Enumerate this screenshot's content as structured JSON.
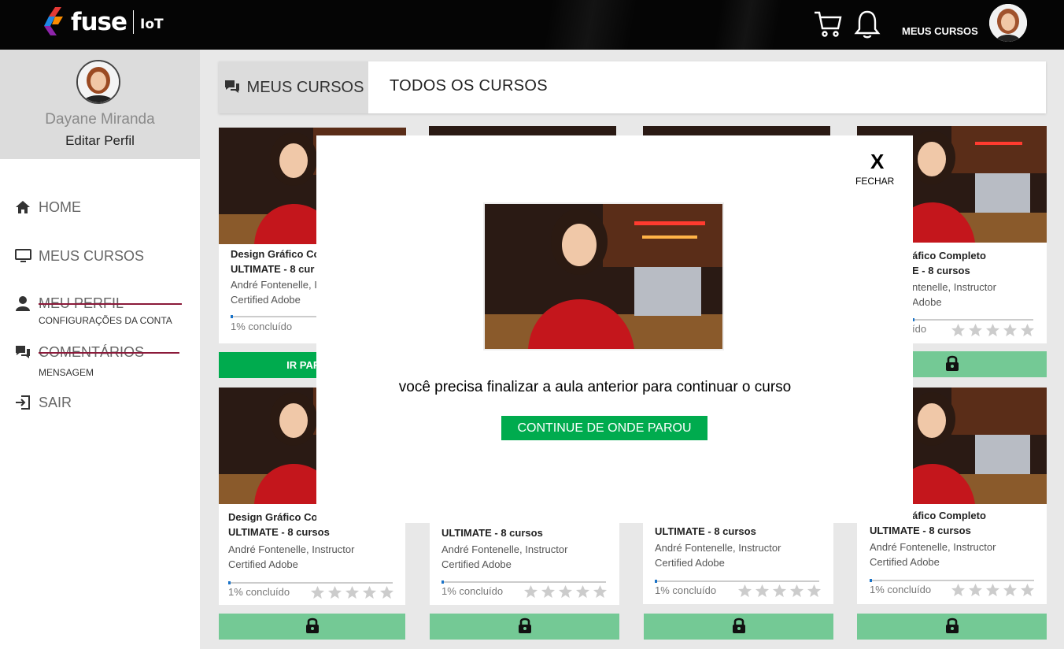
{
  "header": {
    "logo_text": "fuse",
    "logo_sub": "IoT",
    "my_courses_label": "MEUS CURSOS",
    "icons": [
      "cart-icon",
      "bell-icon",
      "avatar"
    ]
  },
  "sidebar": {
    "user_name": "Dayane Miranda",
    "edit_profile": "Editar Perfil",
    "items": [
      {
        "label": "HOME",
        "icon": "home-icon"
      },
      {
        "label": "MEUS CURSOS",
        "icon": "monitor-icon"
      },
      {
        "label": "MEU PERFIL",
        "icon": "user-icon",
        "sub": "CONFIGURAÇÕES DA CONTA",
        "struck": true
      },
      {
        "label": "COMENTÁRIOS",
        "icon": "comments-icon",
        "sub": "MENSAGEM",
        "struck": true
      },
      {
        "label": "SAIR",
        "icon": "logout-icon"
      }
    ]
  },
  "tabs": {
    "active": "MEUS CURSOS",
    "other": "TODOS OS CURSOS"
  },
  "cards": {
    "r1c1": {
      "title1": "Design Gráfico Co",
      "title2": "ULTIMATE - 8 cur",
      "instr1": "André Fontenelle, I",
      "instr2": "Certified Adobe",
      "progress": "1% concluído",
      "button": "IR PARA O"
    },
    "r1c4": {
      "title1": "áfico Completo",
      "title2": "E - 8 cursos",
      "instr1": "ntenelle, Instructor",
      "instr2": "Adobe",
      "progress": "ído"
    },
    "r2c1": {
      "title1": "Design Gráfico Co",
      "title2": "ULTIMATE - 8 cursos",
      "instr1": "André Fontenelle, Instructor",
      "instr2": "Certified Adobe",
      "progress": "1% concluído"
    },
    "r2c2": {
      "title2": "ULTIMATE - 8 cursos",
      "instr1": "André Fontenelle, Instructor",
      "instr2": "Certified Adobe",
      "progress": "1% concluído"
    },
    "r2c3": {
      "title2": "ULTIMATE - 8 cursos",
      "instr1": "André Fontenelle, Instructor",
      "instr2": "Certified Adobe",
      "progress": "1% concluído"
    },
    "r2c4": {
      "title1": "áfico Completo",
      "title2": "ULTIMATE - 8 cursos",
      "instr1": "André Fontenelle, Instructor",
      "instr2": "Certified Adobe",
      "progress": "1% concluído"
    }
  },
  "modal": {
    "close_x": "X",
    "close_label": "FECHAR",
    "message": "você precisa finalizar a aula anterior para continuar o curso",
    "button": "CONTINUE DE ONDE PAROU"
  },
  "colors": {
    "accent_green": "#00ab4e",
    "locked_green": "#74c995",
    "strike": "#8b1a3a",
    "topbar": "#050505"
  }
}
